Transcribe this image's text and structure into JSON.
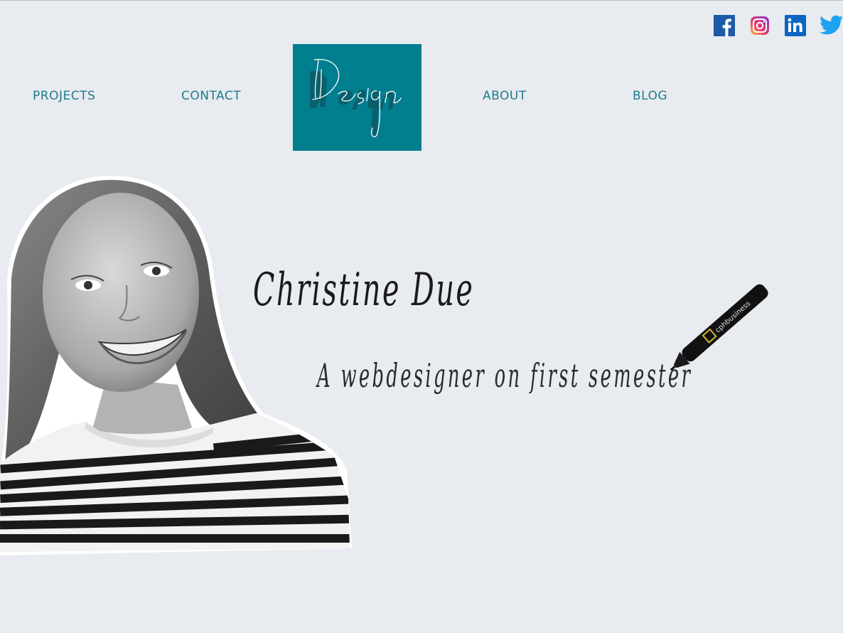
{
  "social": {
    "facebook": "facebook-icon",
    "instagram": "instagram-icon",
    "linkedin": "linkedin-icon",
    "twitter": "twitter-icon"
  },
  "nav": {
    "projects": "PROJECTS",
    "contact": "CONTACT",
    "about": "ABOUT",
    "blog": "BLOG"
  },
  "logo": {
    "text": "DDesign"
  },
  "hero": {
    "name": "Christine Due",
    "tagline": "A webdesigner on first semester"
  },
  "pen": {
    "brand": "cphbusiness"
  },
  "colors": {
    "background": "#e8ebef",
    "accent": "#027f8f",
    "nav_text": "#1f7c8d"
  }
}
